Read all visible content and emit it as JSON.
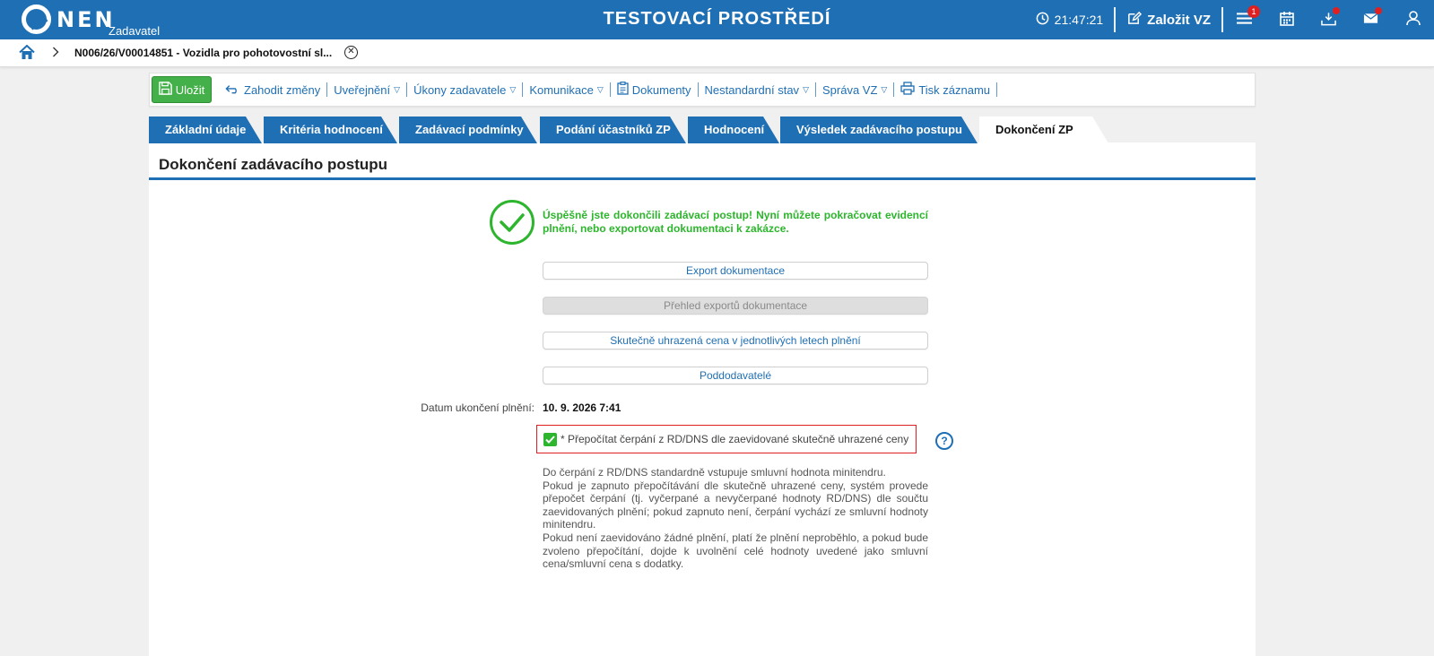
{
  "header": {
    "logo_text": "NEN",
    "logo_sub": "Zadavatel",
    "env_title": "TESTOVACÍ PROSTŘEDÍ",
    "clock": "21:47:21",
    "create_label": "Založit VZ",
    "menu_badge": "1",
    "icons": [
      "clock-icon",
      "edit-icon",
      "menu-icon",
      "calendar-icon",
      "download-icon",
      "mail-icon",
      "user-icon"
    ],
    "accent_color": "#1f6fb4"
  },
  "breadcrumb": {
    "text": "N006/26/V00014851 - Vozidla pro pohotovostní sl..."
  },
  "toolbar": {
    "save_label": "Uložit",
    "discard_label": "Zahodit změny",
    "items": [
      {
        "label": "Uveřejnění"
      },
      {
        "label": "Úkony zadavatele"
      },
      {
        "label": "Komunikace"
      },
      {
        "label": "Dokumenty"
      },
      {
        "label": "Nestandardní stav"
      },
      {
        "label": "Správa VZ"
      },
      {
        "label": "Tisk záznamu"
      }
    ]
  },
  "tabs": [
    {
      "label": "Základní údaje"
    },
    {
      "label": "Kritéria hodnocení"
    },
    {
      "label": "Zadávací podmínky"
    },
    {
      "label": "Podání účastníků ZP"
    },
    {
      "label": "Hodnocení"
    },
    {
      "label": "Výsledek zadávacího postupu"
    },
    {
      "label": "Dokončení ZP"
    }
  ],
  "main": {
    "title": "Dokončení zadávacího postupu",
    "success_message": "Úspěšně jste dokončili zadávací postup! Nyní můžete pokračovat evidencí plnění, nebo exportovat dokumentaci k zakázce.",
    "buttons": [
      {
        "label": "Export dokumentace",
        "disabled": false
      },
      {
        "label": "Přehled exportů dokumentace",
        "disabled": true
      },
      {
        "label": "Skutečně uhrazená cena v jednotlivých letech plnění",
        "disabled": false
      },
      {
        "label": "Poddodavatelé",
        "disabled": false
      }
    ],
    "date_label": "Datum ukončení plnění:",
    "date_value": "10. 9. 2026 7:41",
    "checkbox_label": "* Přepočítat čerpání z RD/DNS dle zaevidované skutečně uhrazené ceny",
    "checkbox_checked": true,
    "help_icon": "?",
    "note_lines": [
      "Do čerpání z RD/DNS standardně vstupuje smluvní hodnota minitendru.",
      "Pokud je zapnuto přepočítávání dle skutečně uhrazené ceny, systém provede přepočet čerpání (tj. vyčerpané a nevyčerpané hodnoty RD/DNS) dle součtu zaevidovaných plnění; pokud zapnuto není, čerpání vychází ze smluvní hodnoty minitendru.",
      "Pokud není zaevidováno žádné plnění, platí že plnění neproběhlo, a pokud bude zvoleno přepočítání, dojde k uvolnění celé hodnoty uvedené jako smluvní cena/smluvní cena s dodatky."
    ],
    "success_color": "#2db52d",
    "highlight_color": "#e02020"
  }
}
